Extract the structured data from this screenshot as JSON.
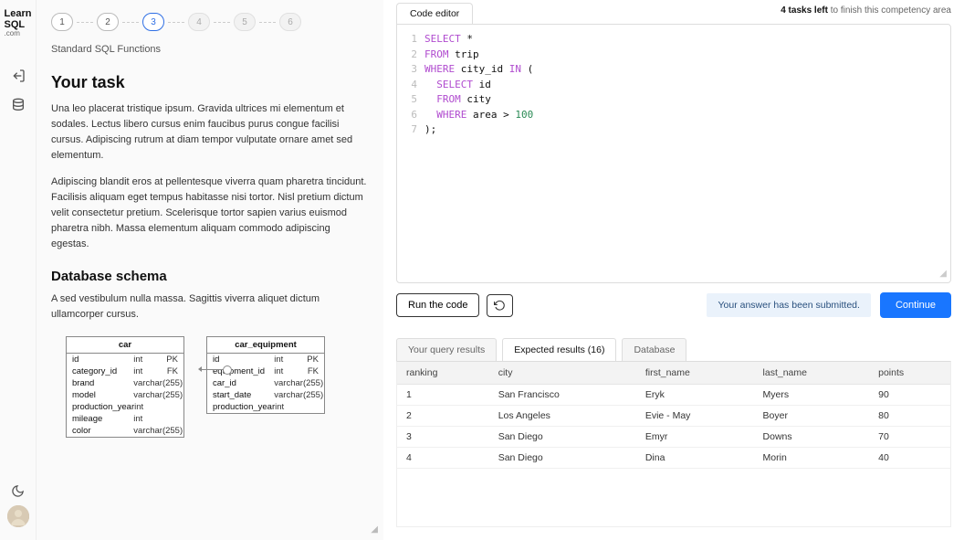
{
  "brand": {
    "line1": "Learn",
    "line2": "SQL",
    "sub": ".com"
  },
  "steps": [
    {
      "n": "1",
      "state": "done"
    },
    {
      "n": "2",
      "state": "done"
    },
    {
      "n": "3",
      "state": "active"
    },
    {
      "n": "4",
      "state": "future"
    },
    {
      "n": "5",
      "state": "future"
    },
    {
      "n": "6",
      "state": "future"
    }
  ],
  "subtitle": "Standard SQL Functions",
  "task": {
    "heading": "Your task",
    "p1": "Una leo placerat tristique ipsum. Gravida ultrices mi elementum et sodales. Lectus libero cursus enim faucibus purus congue facilisi cursus. Adipiscing rutrum at diam tempor vulputate ornare amet sed elementum.",
    "p2": "Adipiscing blandit eros at pellentesque viverra quam pharetra tincidunt. Facilisis aliquam eget tempus habitasse nisi tortor. Nisl pretium dictum velit consectetur pretium. Scelerisque tortor sapien varius euismod pharetra nibh. Massa elementum aliquam commodo adipiscing egestas."
  },
  "schema": {
    "heading": "Database schema",
    "intro": "A sed vestibulum nulla massa. Sagittis viverra aliquet dictum ullamcorper cursus.",
    "entities": [
      {
        "name": "car",
        "cols": [
          {
            "n": "id",
            "t": "int",
            "k": "PK"
          },
          {
            "n": "category_id",
            "t": "int",
            "k": "FK"
          },
          {
            "n": "brand",
            "t": "varchar(255)",
            "k": ""
          },
          {
            "n": "model",
            "t": "varchar(255)",
            "k": ""
          },
          {
            "n": "production_year",
            "t": "int",
            "k": ""
          },
          {
            "n": "mileage",
            "t": "int",
            "k": ""
          },
          {
            "n": "color",
            "t": "varchar(255)",
            "k": ""
          }
        ]
      },
      {
        "name": "car_equipment",
        "cols": [
          {
            "n": "id",
            "t": "int",
            "k": "PK"
          },
          {
            "n": "equipment_id",
            "t": "int",
            "k": "FK"
          },
          {
            "n": "car_id",
            "t": "varchar(255)",
            "k": ""
          },
          {
            "n": "start_date",
            "t": "varchar(255)",
            "k": ""
          },
          {
            "n": "production_year",
            "t": "int",
            "k": ""
          }
        ]
      }
    ]
  },
  "editor": {
    "tab": "Code editor",
    "tasks_left_count": "4 tasks left",
    "tasks_left_rest": " to finish this competency area",
    "run": "Run the code",
    "notice": "Your answer has been submitted.",
    "continue": "Continue",
    "code": [
      [
        {
          "t": "SELECT",
          "c": "kw"
        },
        {
          "t": " *"
        }
      ],
      [
        {
          "t": "FROM",
          "c": "kw"
        },
        {
          "t": " trip"
        }
      ],
      [
        {
          "t": "WHERE",
          "c": "kw"
        },
        {
          "t": " city_id "
        },
        {
          "t": "IN",
          "c": "kw"
        },
        {
          "t": " ("
        }
      ],
      [
        {
          "t": "  "
        },
        {
          "t": "SELECT",
          "c": "kw"
        },
        {
          "t": " id"
        }
      ],
      [
        {
          "t": "  "
        },
        {
          "t": "FROM",
          "c": "kw"
        },
        {
          "t": " city"
        }
      ],
      [
        {
          "t": "  "
        },
        {
          "t": "WHERE",
          "c": "kw"
        },
        {
          "t": " area > "
        },
        {
          "t": "100",
          "c": "num"
        }
      ],
      [
        {
          "t": ");"
        }
      ]
    ]
  },
  "results": {
    "tabs": [
      {
        "label": "Your query results",
        "active": false
      },
      {
        "label": "Expected results (16)",
        "active": true
      },
      {
        "label": "Database",
        "active": false
      }
    ],
    "columns": [
      "ranking",
      "city",
      "first_name",
      "last_name",
      "points"
    ],
    "rows": [
      [
        "1",
        "San Francisco",
        "Eryk",
        "Myers",
        "90"
      ],
      [
        "2",
        "Los Angeles",
        "Evie - May",
        "Boyer",
        "80"
      ],
      [
        "3",
        "San Diego",
        "Emyr",
        "Downs",
        "70"
      ],
      [
        "4",
        "San Diego",
        "Dina",
        "Morin",
        "40"
      ]
    ]
  }
}
